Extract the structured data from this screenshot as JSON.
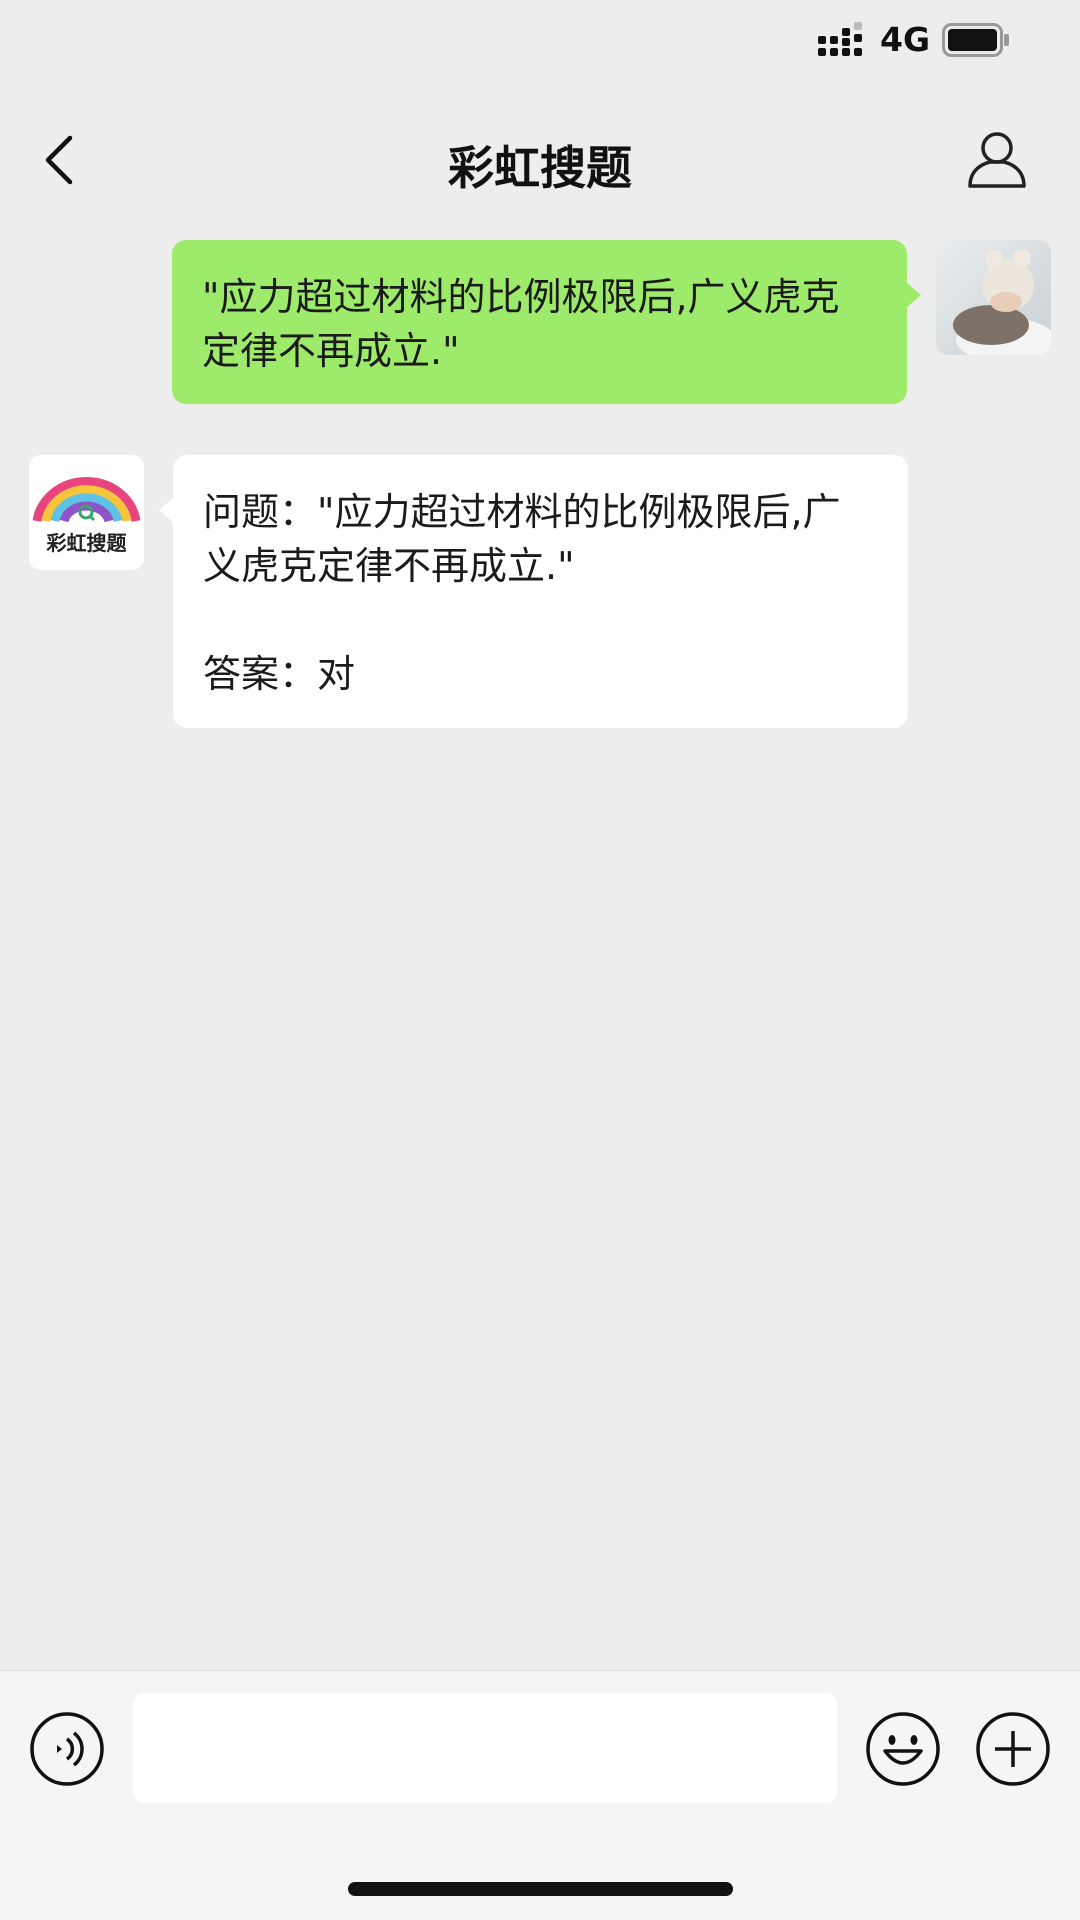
{
  "status_bar": {
    "network": "4G",
    "icons": [
      "signal-icon",
      "battery-icon"
    ]
  },
  "nav": {
    "title": "彩虹搜题",
    "back_icon": "chevron-left-icon",
    "profile_icon": "person-icon"
  },
  "messages": [
    {
      "side": "outgoing",
      "text": "\"应力超过材料的比例极限后,广义虎克定律不再成立.\"",
      "avatar": "baby-photo-avatar"
    },
    {
      "side": "incoming",
      "text": "问题：\"应力超过材料的比例极限后,广义虎克定律不再成立.\"\n\n答案：对",
      "avatar": "rainbow-logo-avatar",
      "avatar_label": "彩虹搜题"
    }
  ],
  "input_bar": {
    "input_value": "",
    "icons": [
      "voice-icon",
      "emoji-icon",
      "plus-icon"
    ]
  },
  "colors": {
    "background": "#ededed",
    "outgoing_bubble": "#9eea6a",
    "incoming_bubble": "#ffffff",
    "input_bar": "#f5f5f5"
  }
}
